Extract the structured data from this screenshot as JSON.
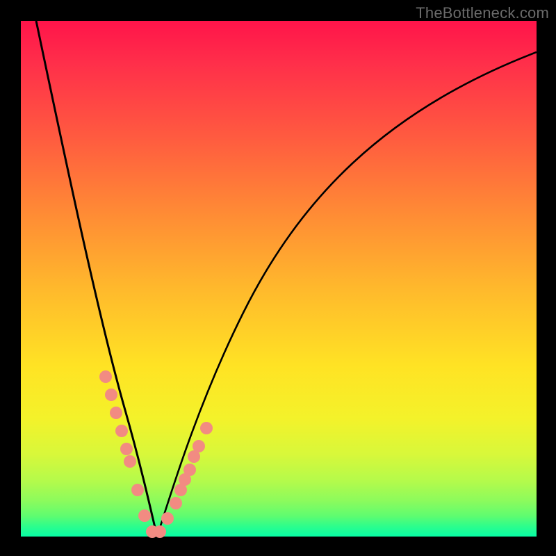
{
  "watermark": "TheBottleneck.com",
  "colors": {
    "dot": "#f28b82",
    "curve": "#000000",
    "frame_bg_top": "#ff144a",
    "frame_bg_bottom": "#07fda5",
    "page_bg": "#000000"
  },
  "chart_data": {
    "type": "line",
    "title": "",
    "xlabel": "",
    "ylabel": "",
    "xlim": [
      0,
      100
    ],
    "ylim": [
      0,
      100
    ],
    "note": "V-shaped bottleneck curve; minimum ≈ x 26 at y ≈ 0. Axis units unlabeled; values are relative percentages estimated from pixel positions.",
    "series": [
      {
        "name": "bottleneck-curve",
        "x": [
          3,
          6,
          9,
          12,
          15,
          18,
          21,
          23,
          25,
          26,
          28,
          30,
          33,
          36,
          40,
          45,
          50,
          56,
          63,
          72,
          82,
          92,
          100
        ],
        "y": [
          100,
          84,
          68,
          53,
          40,
          27,
          16,
          8,
          2,
          0,
          2,
          6,
          12,
          18,
          26,
          35,
          44,
          53,
          62,
          72,
          81,
          89,
          94
        ]
      }
    ],
    "scatter": {
      "name": "highlight-dots",
      "x": [
        16.5,
        17.5,
        18.5,
        19.5,
        20.5,
        21.2,
        22.6,
        24.0,
        25.5,
        27.0,
        28.5,
        30.0,
        31.0,
        31.8,
        32.7,
        33.5,
        34.5,
        36.0
      ],
      "y": [
        31.0,
        27.5,
        24.0,
        20.5,
        17.0,
        14.5,
        9.0,
        4.0,
        1.0,
        1.0,
        3.5,
        6.5,
        9.0,
        11.0,
        13.0,
        15.5,
        17.5,
        21.0
      ]
    }
  }
}
